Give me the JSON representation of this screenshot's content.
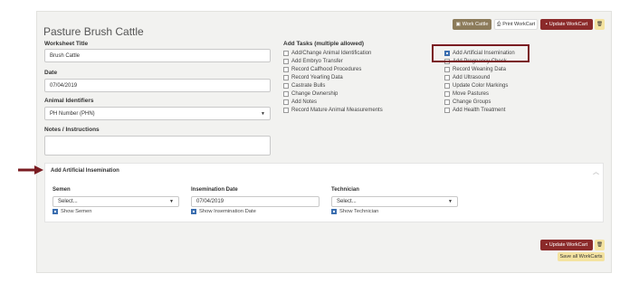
{
  "page": {
    "title": "Pasture Brush Cattle"
  },
  "toolbar": {
    "work_cattle_label": "Work Cattle",
    "print_label": "Print WorkCart",
    "update_label": "Update WorkCart"
  },
  "form": {
    "worksheet_title_label": "Worksheet Title",
    "worksheet_title_value": "Brush Cattle",
    "date_label": "Date",
    "date_value": "07/04/2019",
    "animal_identifiers_label": "Animal Identifiers",
    "animal_identifiers_value": "PH Number (PHN)",
    "notes_label": "Notes / Instructions"
  },
  "tasks": {
    "label": "Add Tasks (multiple allowed)",
    "col1": [
      {
        "label": "Add/Change Animal Identification",
        "checked": false
      },
      {
        "label": "Add Embryo Transfer",
        "checked": false
      },
      {
        "label": "Record Calfhood Procedures",
        "checked": false
      },
      {
        "label": "Record Yearling Data",
        "checked": false
      },
      {
        "label": "Castrate Bulls",
        "checked": false
      },
      {
        "label": "Change Ownership",
        "checked": false
      },
      {
        "label": "Add Notes",
        "checked": false
      },
      {
        "label": "Record Mature Animal Measurements",
        "checked": false
      }
    ],
    "col2": [
      {
        "label": "Add Artificial Insemination",
        "checked": true
      },
      {
        "label": "Add Pregnancy Check",
        "checked": false
      },
      {
        "label": "Record Weaning Data",
        "checked": false
      },
      {
        "label": "Add Ultrasound",
        "checked": false
      },
      {
        "label": "Update Color Markings",
        "checked": false
      },
      {
        "label": "Move Pastures",
        "checked": false
      },
      {
        "label": "Change Groups",
        "checked": false
      },
      {
        "label": "Add Health Treatment",
        "checked": false
      }
    ]
  },
  "ai_section": {
    "title": "Add Artificial Insemination",
    "semen_label": "Semen",
    "semen_value": "Select...",
    "show_semen": "Show Semen",
    "insem_date_label": "Insemination Date",
    "insem_date_value": "07/04/2019",
    "show_insem_date": "Show Insemination Date",
    "technician_label": "Technician",
    "technician_value": "Select...",
    "show_technician": "Show Technician"
  },
  "footer": {
    "update_label": "Update WorkCart",
    "save_all_label": "Save all WorkCarts"
  },
  "colors": {
    "accent_red": "#8b2a2a",
    "olive": "#8c7b5a",
    "highlight": "#7a1c22",
    "checkbox_blue": "#3c6fb0"
  }
}
